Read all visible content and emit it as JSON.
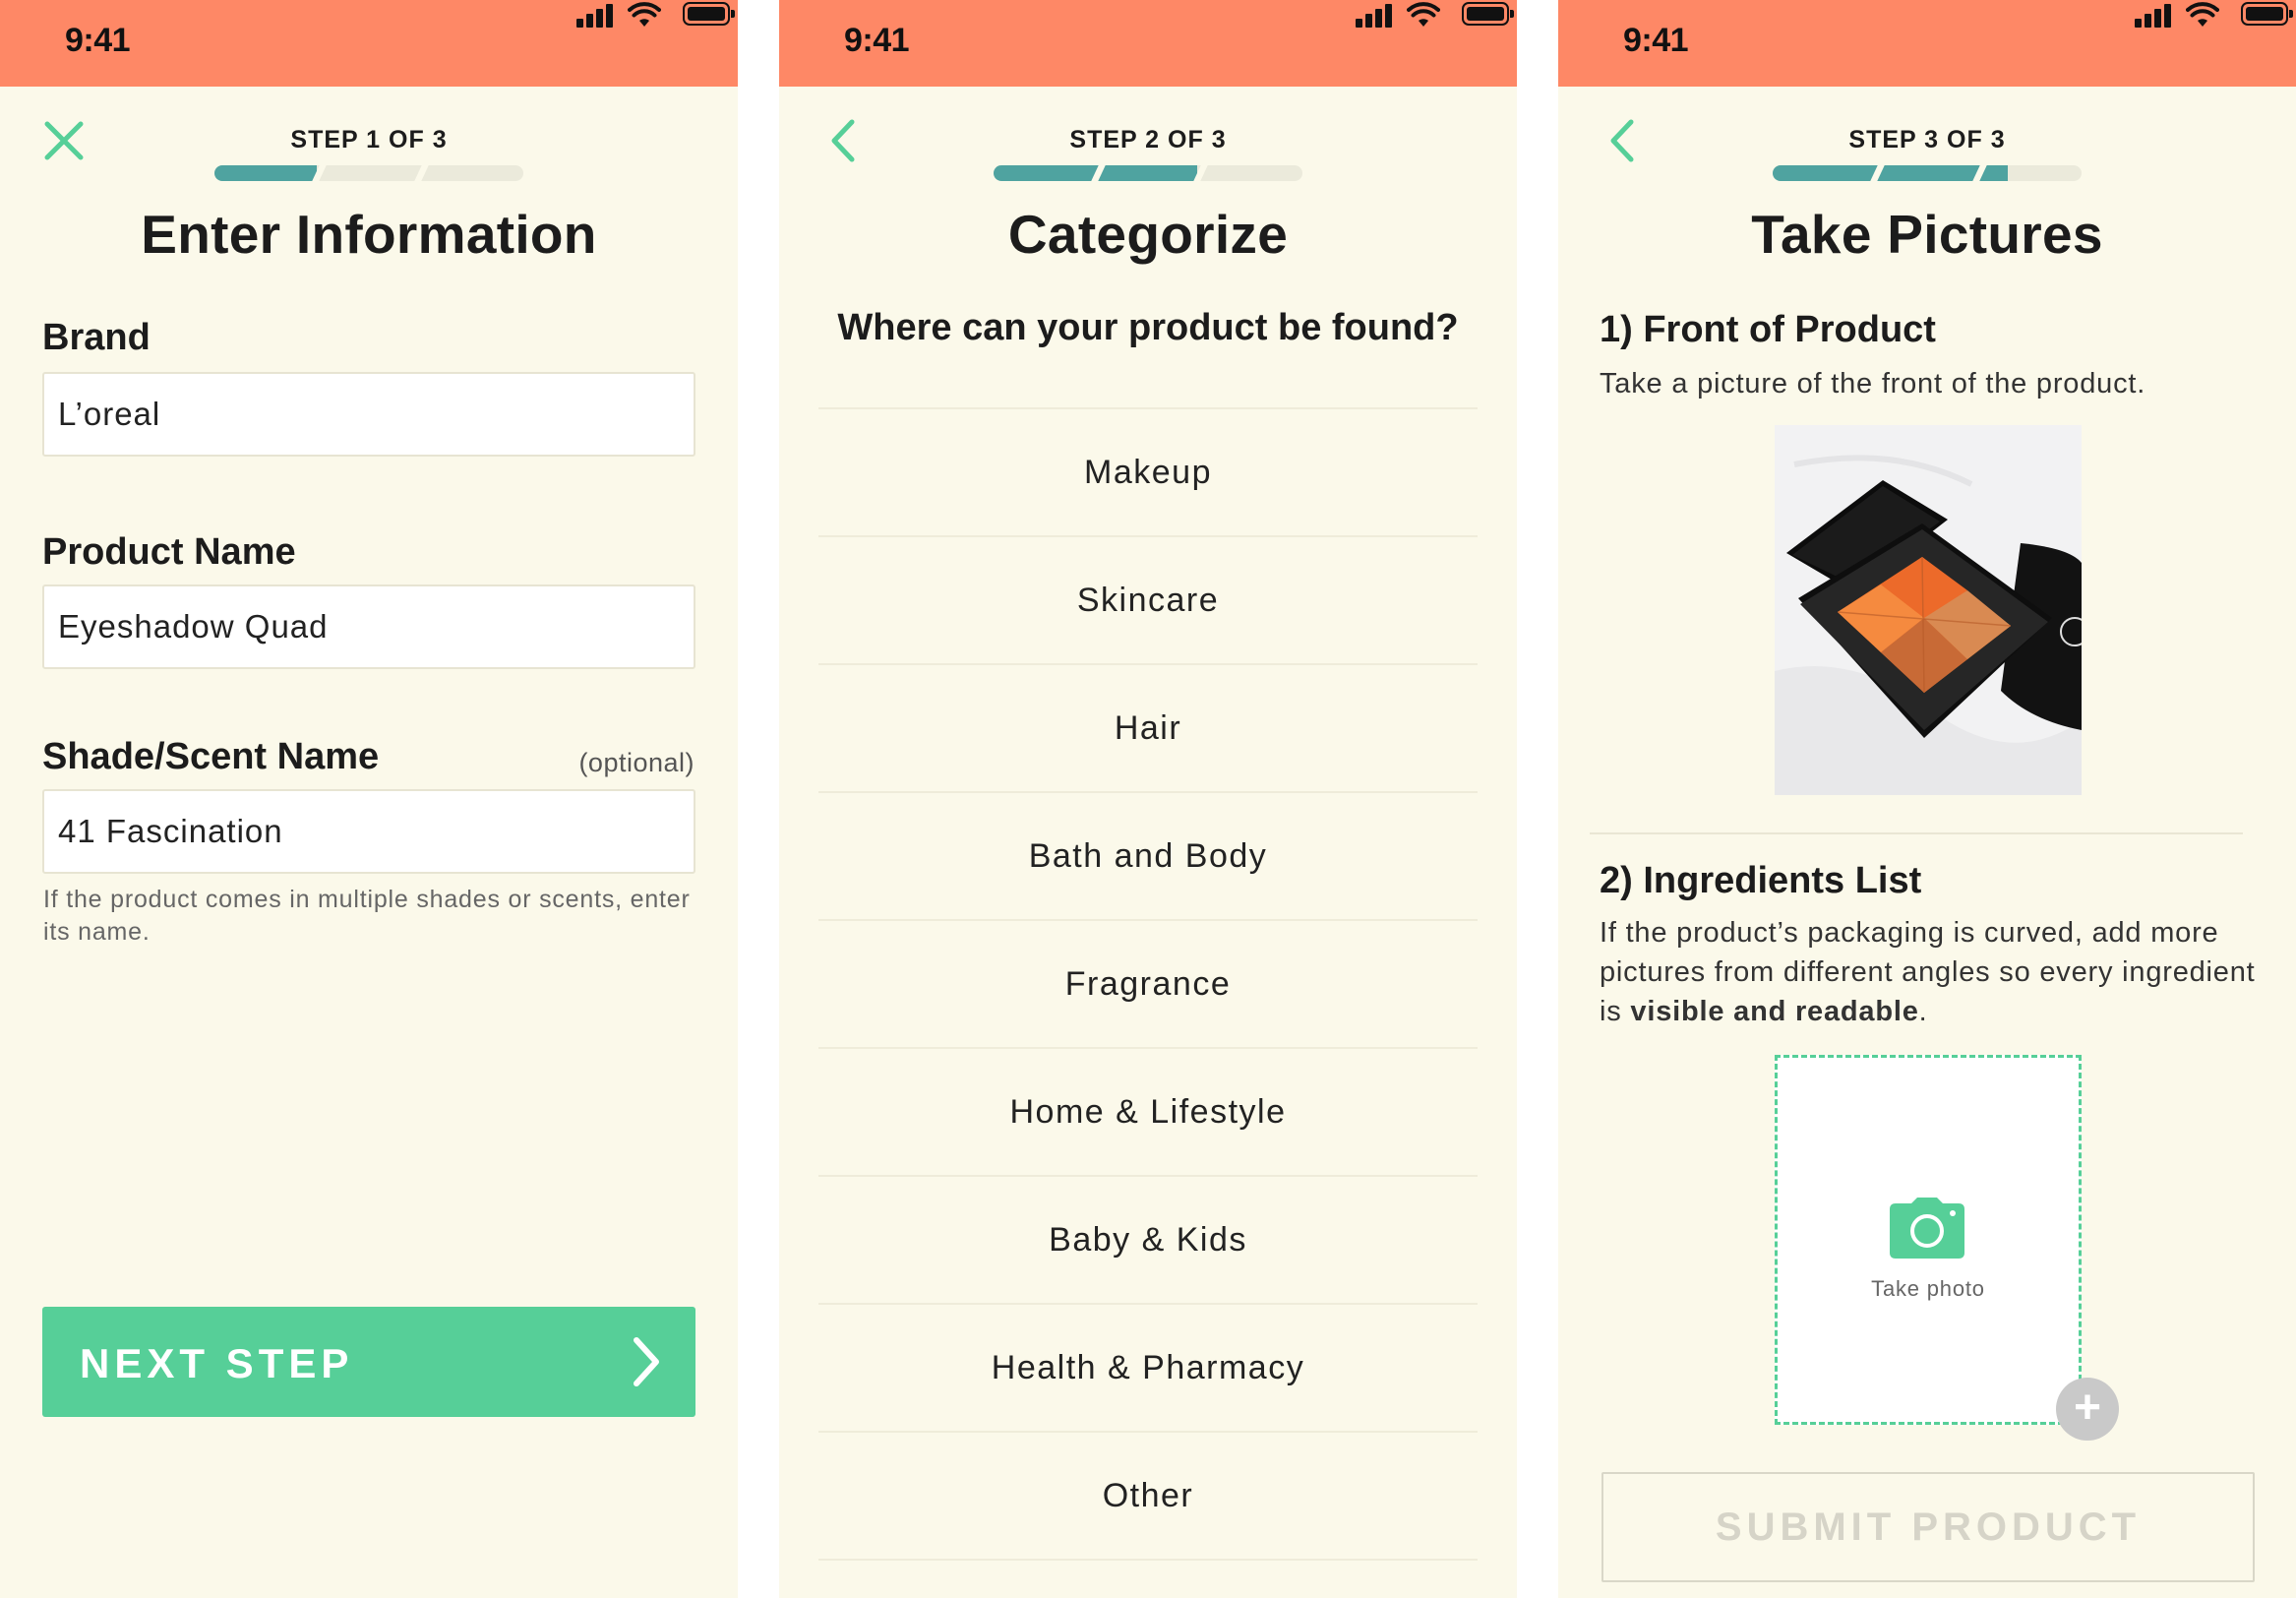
{
  "colors": {
    "status_bar": "#fe8866",
    "background": "#fbf9ea",
    "accent_green": "#56cf98",
    "progress_teal": "#4fa3a0",
    "progress_track": "#ebeadb"
  },
  "status_bar": {
    "time": "9:41",
    "icons": [
      "signal-icon",
      "wifi-icon",
      "battery-icon"
    ]
  },
  "screen1": {
    "nav_icon": "close-icon",
    "step_label": "STEP 1 OF 3",
    "progress": 0.33,
    "title": "Enter Information",
    "fields": {
      "brand": {
        "label": "Brand",
        "value": "L’oreal"
      },
      "product_name": {
        "label": "Product Name",
        "value": "Eyeshadow Quad"
      },
      "shade": {
        "label": "Shade/Scent Name",
        "optional": "(optional)",
        "value": "41 Fascination",
        "helper": "If the product comes in multiple shades or scents, enter its name."
      }
    },
    "next_button": {
      "label": "NEXT STEP",
      "icon": "chevron-right-icon"
    }
  },
  "screen2": {
    "nav_icon": "back-chevron-icon",
    "step_label": "STEP 2 OF 3",
    "progress": 0.66,
    "title": "Categorize",
    "question": "Where can your product be found?",
    "categories": [
      "Makeup",
      "Skincare",
      "Hair",
      "Bath and Body",
      "Fragrance",
      "Home & Lifestyle",
      "Baby & Kids",
      "Health & Pharmacy",
      "Other"
    ]
  },
  "screen3": {
    "nav_icon": "back-chevron-icon",
    "step_label": "STEP 3 OF 3",
    "progress": 0.76,
    "title": "Take Pictures",
    "front": {
      "heading": "1) Front of Product",
      "text": "Take a picture of the front of the product."
    },
    "ingredients": {
      "heading": "2) Ingredients List",
      "text_before": "If the product’s packaging is curved, add more pictures from different angles so  every ingredient is ",
      "text_bold": "visible and readable",
      "text_after": "."
    },
    "take_photo_label": "Take photo",
    "add_button_label": "+",
    "submit_label": "SUBMIT PRODUCT"
  }
}
